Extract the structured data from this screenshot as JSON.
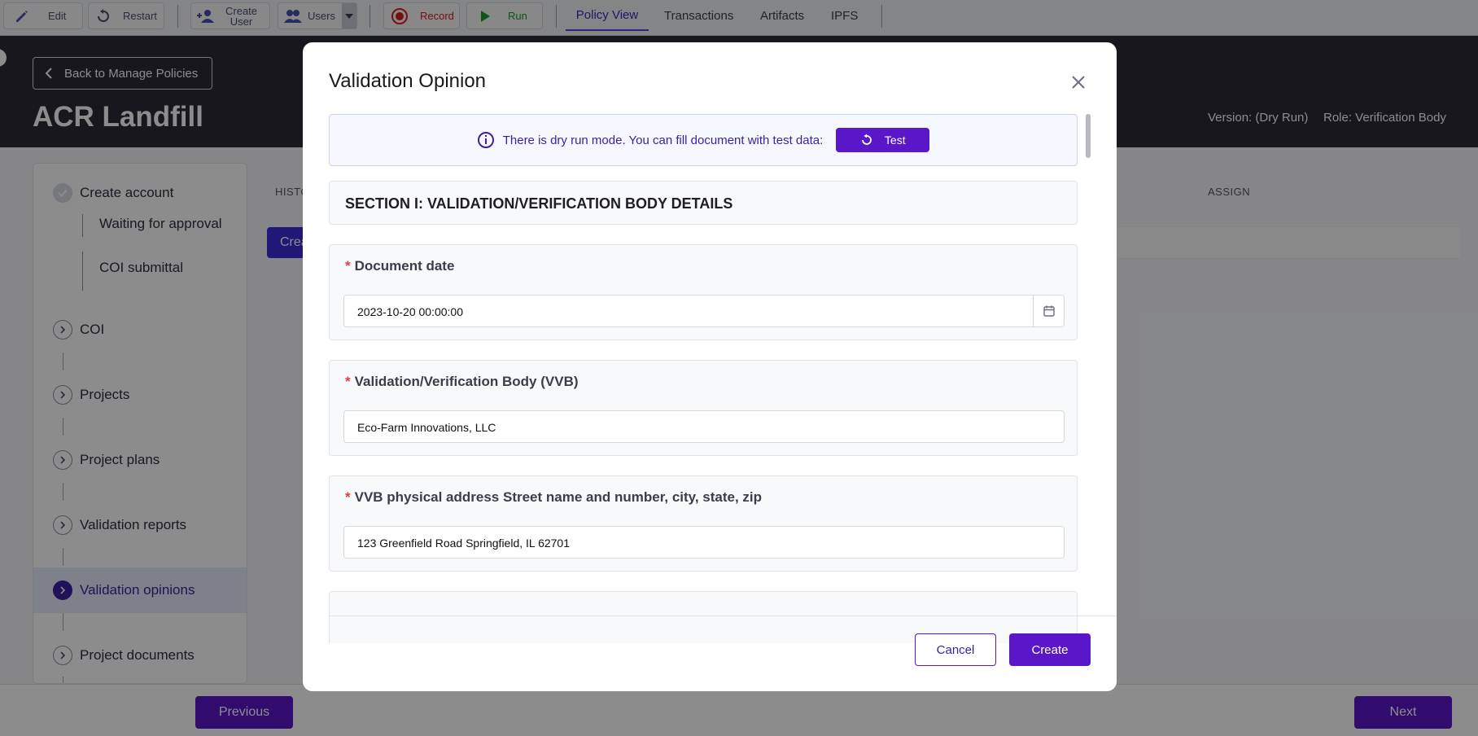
{
  "toolbar": {
    "edit": "Edit",
    "restart": "Restart",
    "create_user_line1": "Create",
    "create_user_line2": "User",
    "users": "Users",
    "record": "Record",
    "run": "Run",
    "tabs": [
      {
        "label": "Policy View",
        "active": true
      },
      {
        "label": "Transactions",
        "active": false
      },
      {
        "label": "Artifacts",
        "active": false
      },
      {
        "label": "IPFS",
        "active": false
      }
    ]
  },
  "header": {
    "back_label": "Back to Manage Policies",
    "title": "ACR Landfill",
    "version": "Version: (Dry Run)",
    "role": "Role: Verification Body"
  },
  "sidebar": {
    "steps": [
      {
        "label": "Create account",
        "state": "done"
      },
      {
        "label": "Waiting for approval",
        "sub": true
      },
      {
        "label": "COI submittal",
        "sub": true
      },
      {
        "label": "COI"
      },
      {
        "label": "Projects"
      },
      {
        "label": "Project plans"
      },
      {
        "label": "Validation reports"
      },
      {
        "label": "Validation opinions",
        "active": true
      },
      {
        "label": "Project documents"
      }
    ]
  },
  "main": {
    "col_history": "HISTO",
    "col_assign": "ASSIGN",
    "create_partial": "Crea"
  },
  "footer": {
    "previous": "Previous",
    "next": "Next"
  },
  "modal": {
    "title": "Validation Opinion",
    "notice_text": "There is dry run mode. You can fill document with test data:",
    "test_button": "Test",
    "section_title": "SECTION I: VALIDATION/VERIFICATION BODY DETAILS",
    "fields": [
      {
        "label": "Document date",
        "value": "2023-10-20 00:00:00",
        "required": true
      },
      {
        "label": "Validation/Verification Body (VVB)",
        "value": "Eco-Farm Innovations, LLC",
        "required": true
      },
      {
        "label": "VVB physical address Street name and number, city, state, zip",
        "value": "123 Greenfield Road Springfield, IL 62701",
        "required": true
      }
    ],
    "cancel": "Cancel",
    "create": "Create"
  },
  "colors": {
    "accent": "#5a16c9",
    "header_bg": "#2a2b35",
    "required": "#e04040"
  }
}
